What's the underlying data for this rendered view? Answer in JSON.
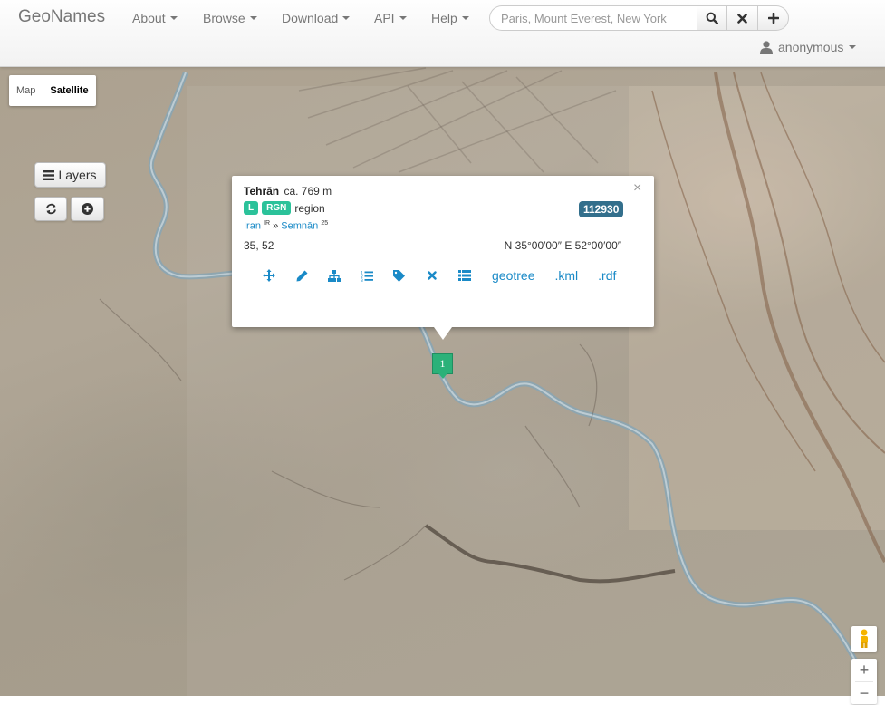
{
  "navbar": {
    "brand": "GeoNames",
    "menus": [
      "About",
      "Browse",
      "Download",
      "API",
      "Help"
    ],
    "search_placeholder": "Paris, Mount Everest, New York",
    "user": "anonymous"
  },
  "map": {
    "type_map": "Map",
    "type_satellite": "Satellite",
    "selected_type": "Satellite",
    "layers_label": "Layers",
    "zoom_in": "+",
    "zoom_out": "−"
  },
  "popup": {
    "name": "Tehrān",
    "elevation": "ca. 769 m",
    "feature_class": "L",
    "feature_code": "RGN",
    "feature_desc": "region",
    "geonameid": "112930",
    "country": "Iran",
    "country_code": "IR",
    "admin": "Semnān",
    "admin_code": "25",
    "latlng": "35, 52",
    "dms": "N 35°00′00″ E 52°00′00″",
    "links": [
      ".kml",
      ".rdf"
    ],
    "geotree": "geotree",
    "close": "×"
  },
  "marker": {
    "label": "1"
  },
  "colors": {
    "accent_teal": "#2bc29a",
    "badge_blue": "#336f8c",
    "link_blue": "#1a8ac7",
    "marker_green": "#2bb179"
  }
}
